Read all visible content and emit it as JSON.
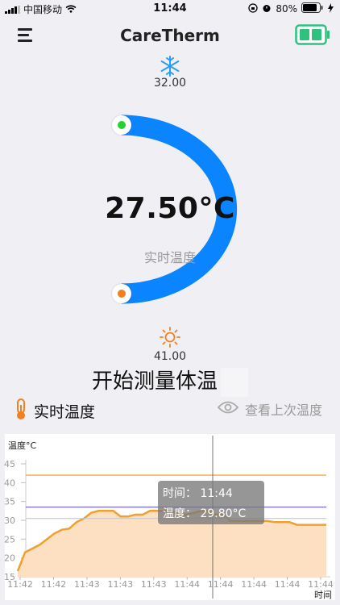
{
  "status_bar": {
    "carrier": "中国移动",
    "time": "11:44",
    "battery": "80%"
  },
  "nav": {
    "title": "CareTherm",
    "device_battery_color": "#2ec27e"
  },
  "dial": {
    "min_label": "32.00",
    "max_label": "41.00",
    "current_temp": "27.50°C",
    "current_caption": "实时温度",
    "arc_color": "#0a84ff",
    "cold_icon": "snowflake-icon",
    "hot_icon": "sun-icon"
  },
  "actions": {
    "start_label": "开始测量体温",
    "realtime_label": "实时温度",
    "last_label": "查看上次温度"
  },
  "chart": {
    "ylabel": "温度°C",
    "xlabel": "时间",
    "tooltip_time": "时间：  11:44",
    "tooltip_temp": "温度：  29.80°C"
  },
  "chart_data": {
    "type": "area",
    "ylabel": "温度°C",
    "xlabel": "时间",
    "ylim": [
      15,
      45
    ],
    "yticks": [
      15,
      20,
      25,
      30,
      35,
      40,
      45
    ],
    "xticks": [
      "11:42",
      "11:42",
      "11:43",
      "11:43",
      "11:43",
      "11:44",
      "11:44",
      "11:44",
      "11:44",
      "11:44"
    ],
    "reference_lines": [
      {
        "value": 42,
        "color": "#f0a030"
      },
      {
        "value": 33.5,
        "color": "#6a5acd"
      },
      {
        "value": 30.5,
        "color": "#c8c8c8"
      }
    ],
    "series": [
      {
        "values": [
          16.5,
          21.5,
          22.5,
          23.5,
          25,
          26.5,
          27.5,
          27.8,
          29.5,
          30.5,
          32,
          32.5,
          32.5,
          32.5,
          31,
          31,
          31.5,
          31.5,
          32.5,
          32.5,
          32.5,
          32.5,
          31.5,
          31.5,
          32,
          32.5,
          32.5,
          31.5,
          31.5,
          29.8,
          29.8,
          29.8,
          29.8,
          29.8,
          29.8,
          29.5,
          29.5,
          29.5,
          28.8,
          28.8,
          28.8,
          28.8,
          28.8
        ],
        "color": "#f0a030",
        "fill": "#fde0c2"
      }
    ]
  }
}
